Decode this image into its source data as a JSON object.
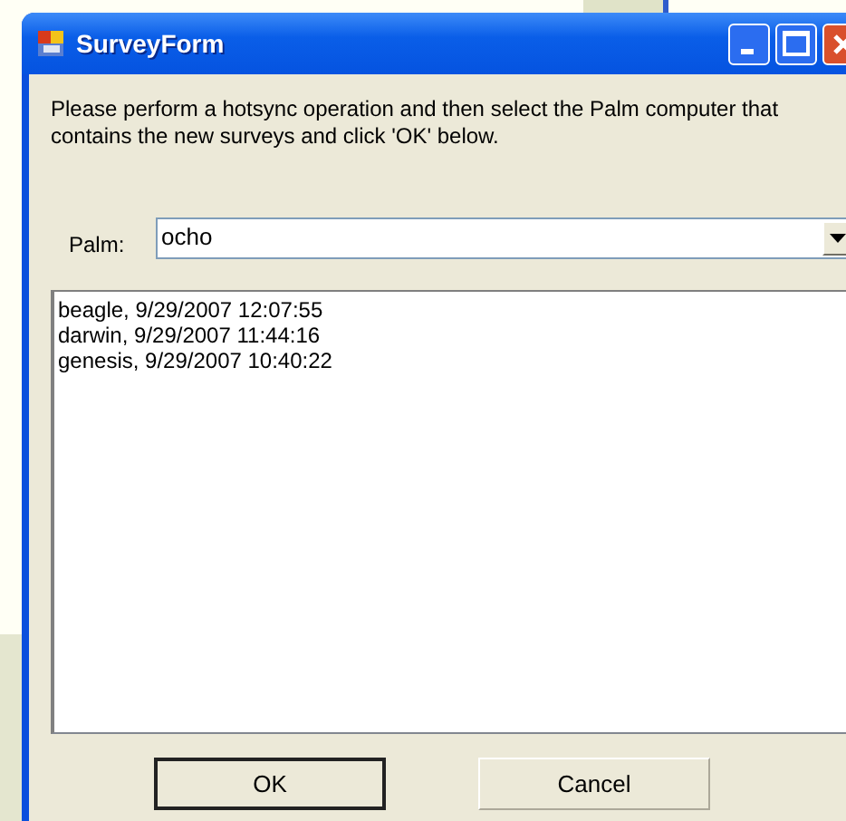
{
  "window": {
    "title": "SurveyForm"
  },
  "message": "Please perform a hotsync operation and then select the Palm computer that contains the new surveys and click 'OK' below.",
  "palm": {
    "label": "Palm:",
    "value": "ocho"
  },
  "surveys": [
    "beagle, 9/29/2007 12:07:55",
    "darwin, 9/29/2007 11:44:16",
    "genesis, 9/29/2007 10:40:22"
  ],
  "buttons": [
    {
      "label": "OK",
      "default": true
    },
    {
      "label": "Cancel",
      "default": false
    }
  ]
}
